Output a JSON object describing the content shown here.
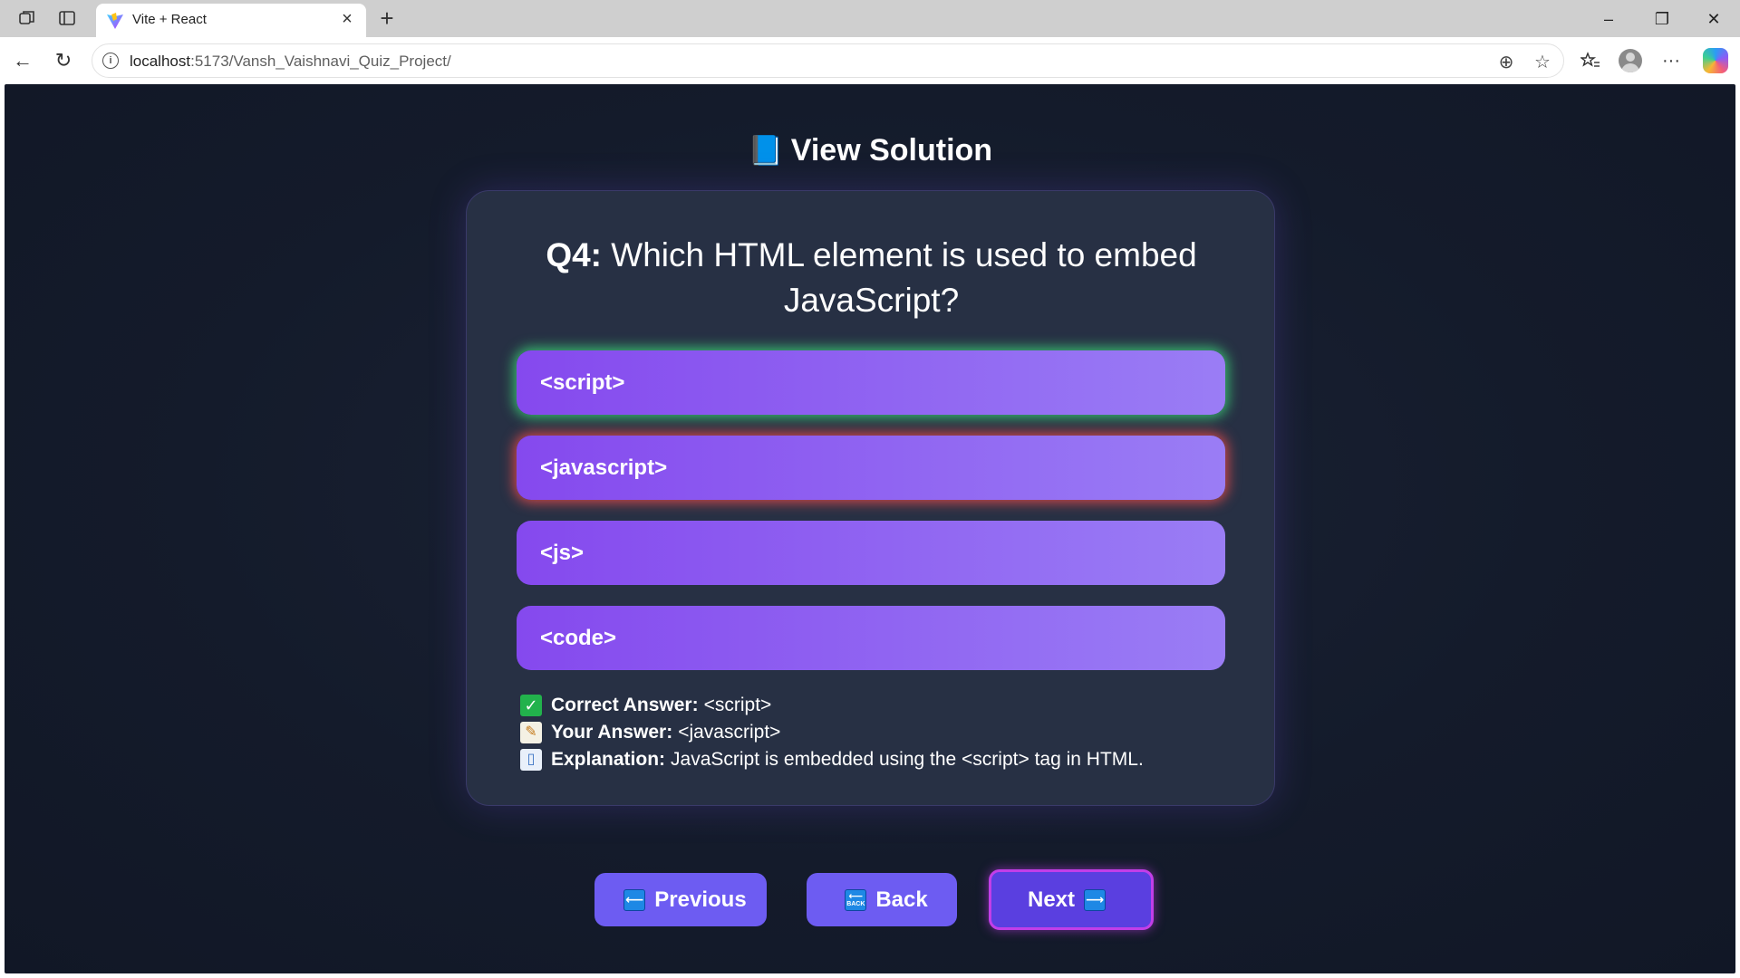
{
  "browser": {
    "tab_title": "Vite + React",
    "url_host": "localhost",
    "url_path": ":5173/Vansh_Vaishnavi_Quiz_Project/",
    "icons": {
      "workspaces": "workspaces-icon",
      "tab_actions": "vertical-tabs-icon",
      "close_tab": "×",
      "new_tab": "+",
      "minimize": "–",
      "maximize": "❐",
      "close_window": "✕",
      "back": "←",
      "refresh": "↻",
      "zoom": "⊕",
      "favorite": "☆",
      "favorites": "☆",
      "more": "···"
    }
  },
  "page": {
    "title": "View Solution",
    "title_icon": "📘"
  },
  "question": {
    "label": "Q4:",
    "text": "Which HTML element is used to embed JavaScript?"
  },
  "options": [
    {
      "text": "<script>",
      "state": "correct"
    },
    {
      "text": "<javascript>",
      "state": "wrong"
    },
    {
      "text": "<js>",
      "state": "neutral"
    },
    {
      "text": "<code>",
      "state": "neutral"
    }
  ],
  "details": {
    "correct_label": "Correct Answer:",
    "correct_value": "<script>",
    "your_label": "Your Answer:",
    "your_value": "<javascript>",
    "explanation_label": "Explanation:",
    "explanation_value": "JavaScript is embedded using the <script> tag in HTML."
  },
  "navigation": {
    "previous_label": "Previous",
    "back_label": "Back",
    "next_label": "Next",
    "previous_icon": "⟵",
    "next_icon": "⟶",
    "back_icon": "BACK"
  },
  "colors": {
    "background": "#141b2b",
    "card": "#273044",
    "option_start": "#8549ee",
    "option_end": "#9a7df5",
    "correct_glow": "#3cd278",
    "wrong_glow": "#eb4b4b",
    "button": "#6d5cf2",
    "next_border": "#c23ee8"
  }
}
